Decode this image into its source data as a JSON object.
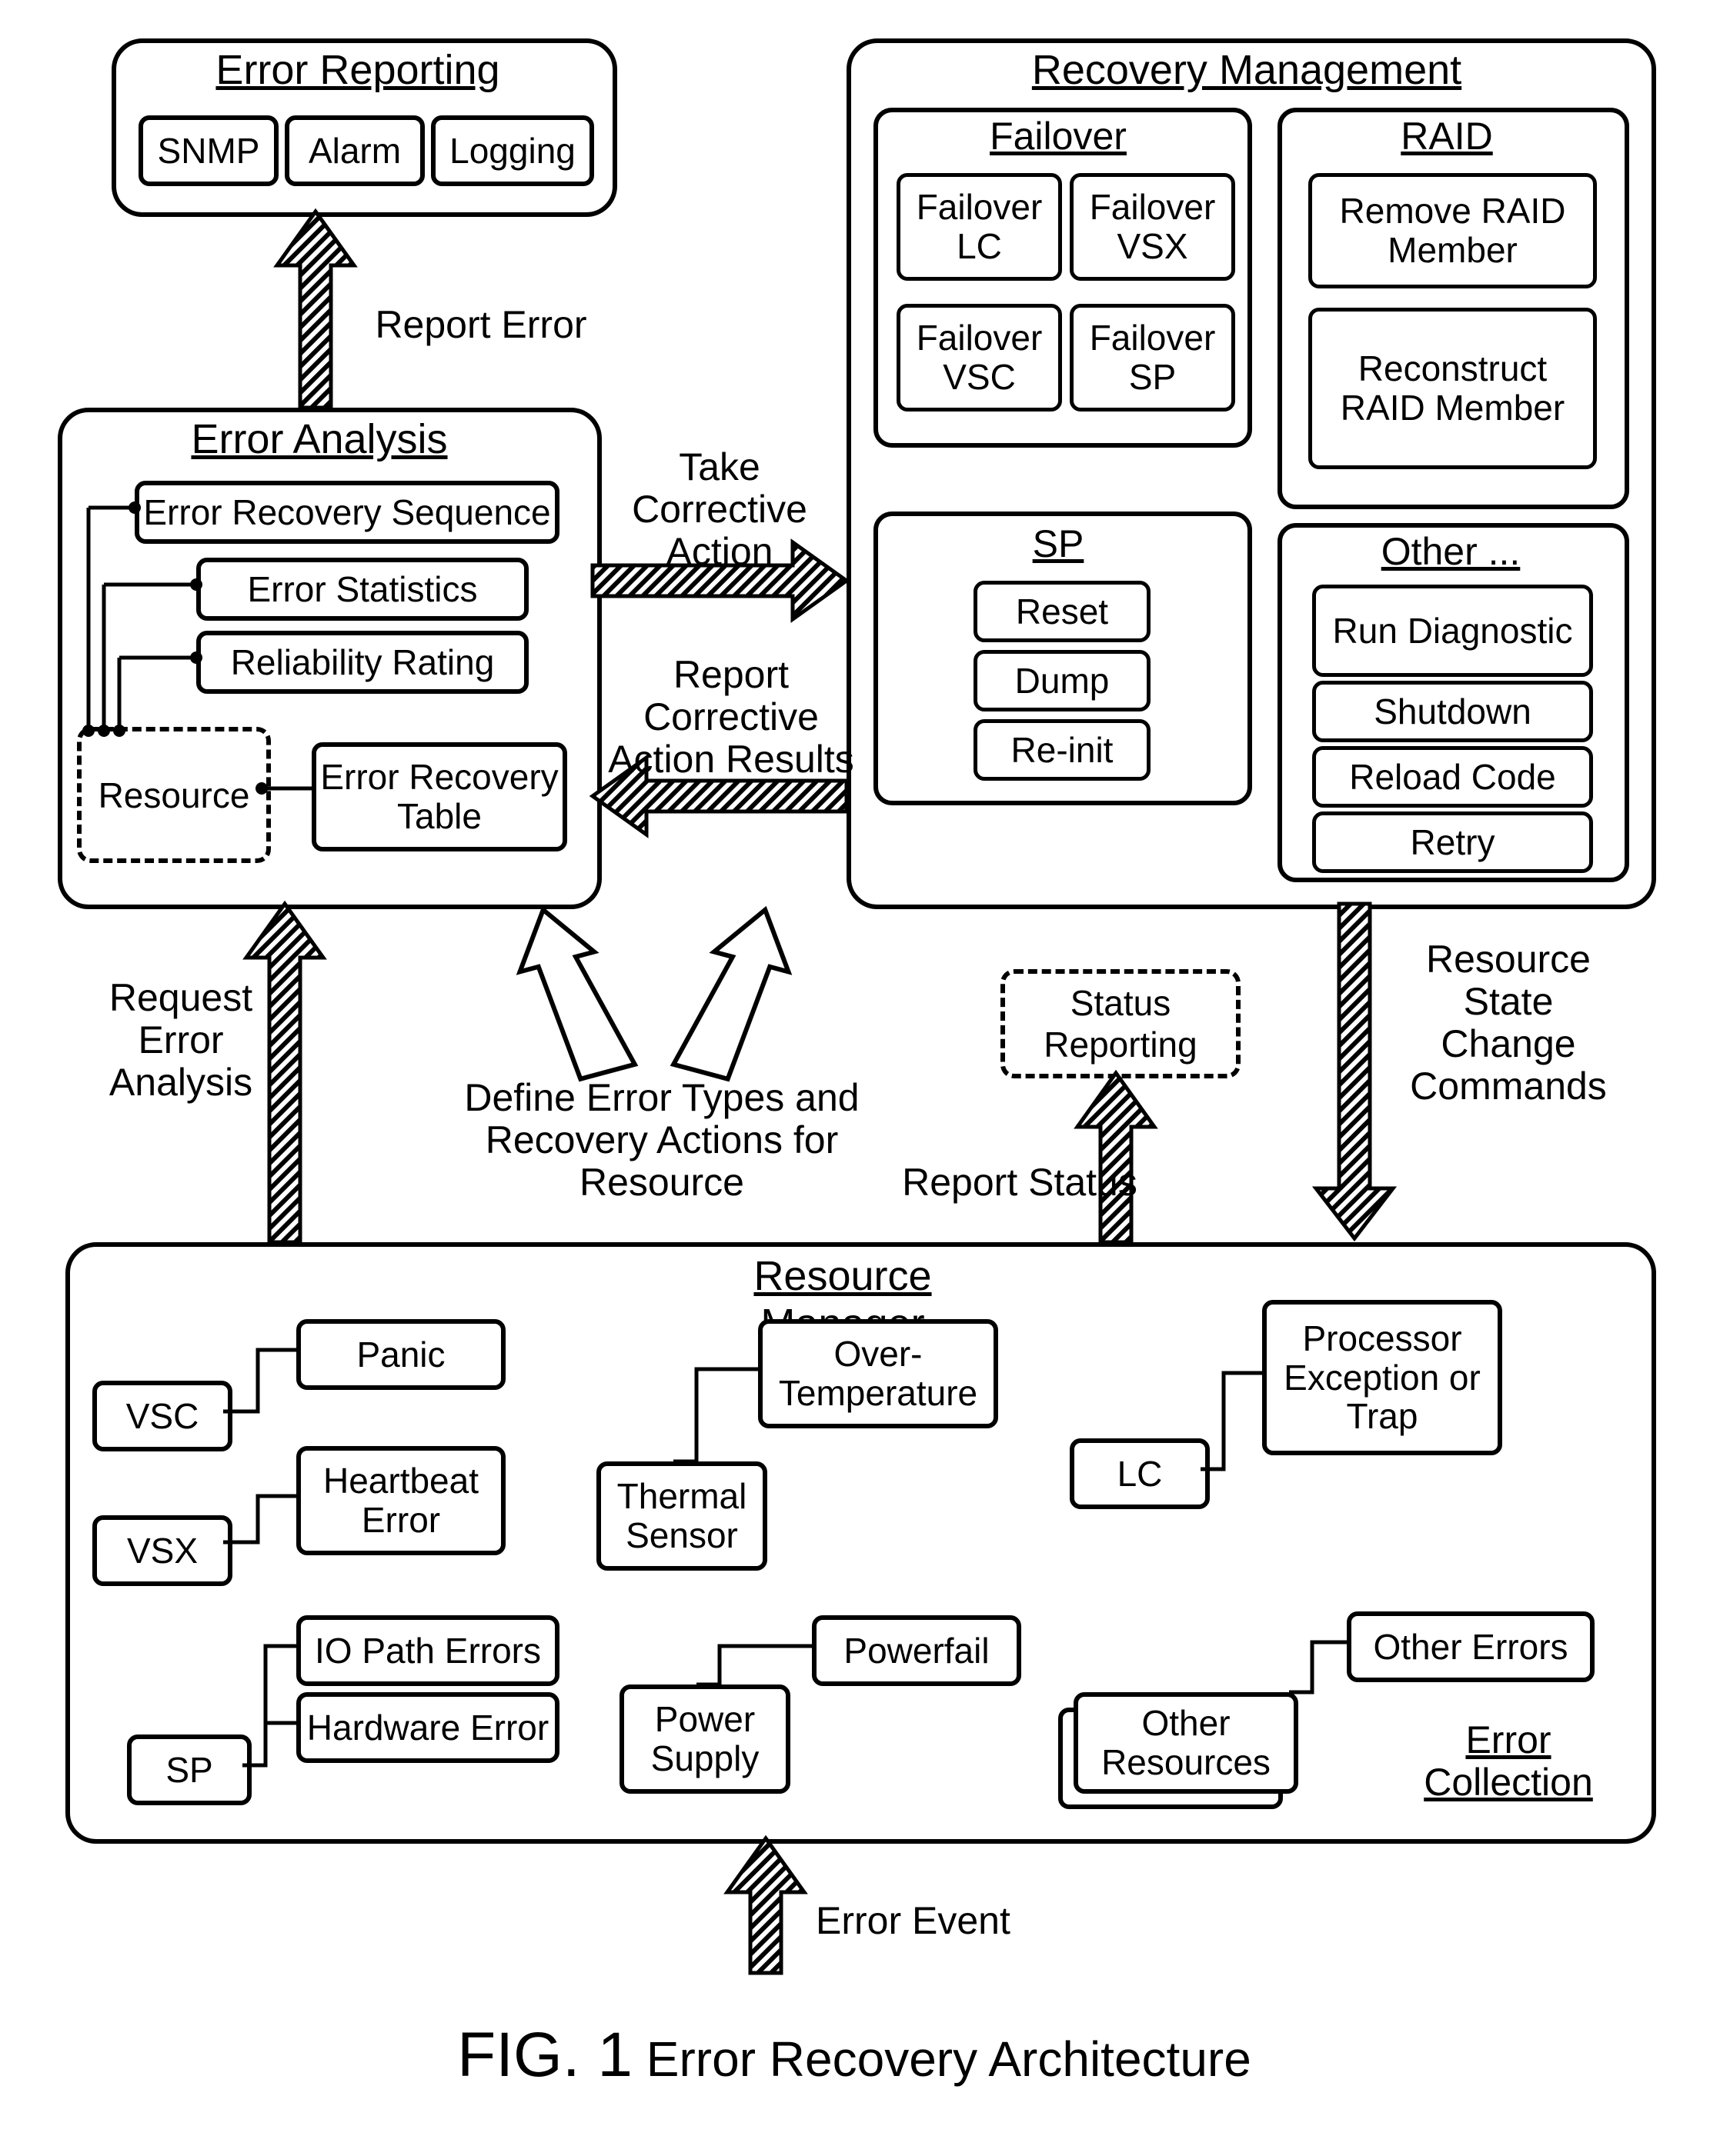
{
  "error_reporting": {
    "title": "Error Reporting",
    "snmp": "SNMP",
    "alarm": "Alarm",
    "logging": "Logging"
  },
  "error_analysis": {
    "title": "Error Analysis",
    "ers": "Error Recovery Sequence",
    "stats": "Error Statistics",
    "rr": "Reliability Rating",
    "resource": "Resource",
    "ert": "Error Recovery Table"
  },
  "recovery_mgmt": {
    "title": "Recovery Management",
    "failover": {
      "title": "Failover",
      "lc": "Failover LC",
      "vsx": "Failover VSX",
      "vsc": "Failover VSC",
      "sp": "Failover SP"
    },
    "raid": {
      "title": "RAID",
      "remove": "Remove RAID Member",
      "recon": "Reconstruct RAID Member"
    },
    "sp": {
      "title": "SP",
      "reset": "Reset",
      "dump": "Dump",
      "reinit": "Re-init"
    },
    "other": {
      "title": "Other ...",
      "diag": "Run Diagnostic",
      "shutdown": "Shutdown",
      "reload": "Reload Code",
      "retry": "Retry"
    }
  },
  "resource_mgr": {
    "title": "Resource Manager",
    "vsc": "VSC",
    "panic": "Panic",
    "vsx": "VSX",
    "hb": "Heartbeat Error",
    "sp": "SP",
    "io": "IO Path Errors",
    "hw": "Hardware Error",
    "thermal": "Thermal Sensor",
    "overtemp": "Over-Temperature",
    "power": "Power Supply",
    "pfail": "Powerfail",
    "lc": "LC",
    "procex": "Processor Exception or Trap",
    "other_res": "Other Resources",
    "other_err": "Other Errors",
    "errcoll": "Error Collection"
  },
  "status_reporting": "Status Reporting",
  "arrows": {
    "report_error": "Report Error",
    "take_action": "Take Corrective Action",
    "report_results": "Report Corrective Action Results",
    "req_analysis": "Request Error Analysis",
    "define": "Define Error Types and Recovery Actions for Resource",
    "report_status": "Report Status",
    "state_change": "Resource State Change Commands",
    "error_event": "Error Event"
  },
  "caption": {
    "fig": "FIG. 1",
    "text": "Error Recovery Architecture"
  }
}
